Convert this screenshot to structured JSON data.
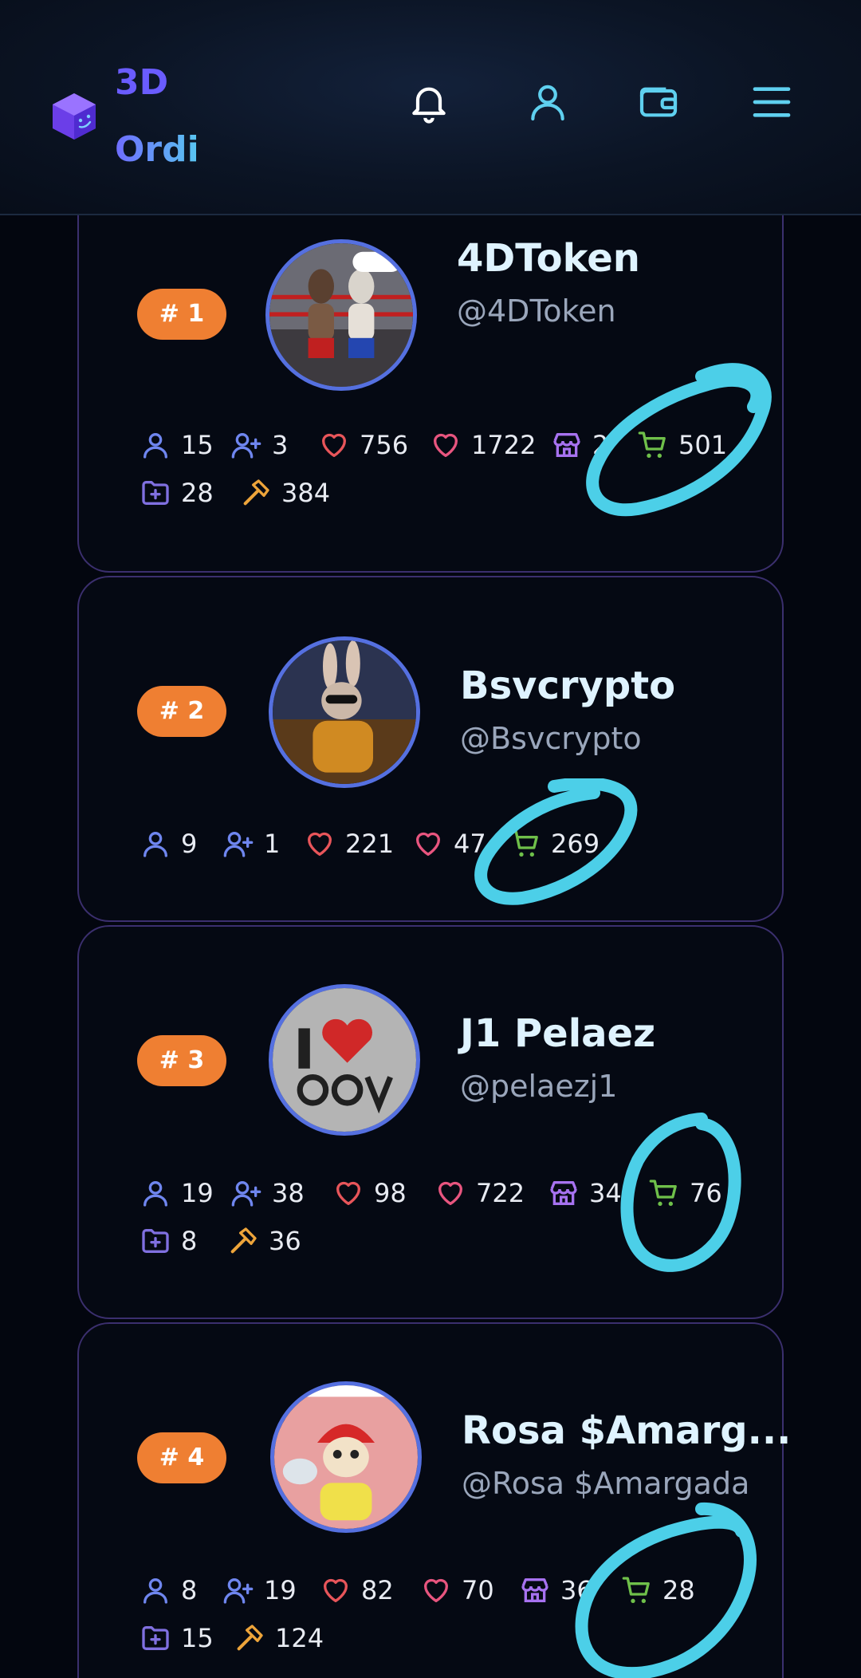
{
  "app": {
    "logo_line1": "3D",
    "logo_line2": "Ordi"
  },
  "header": {
    "icons": [
      "bell-icon",
      "user-icon",
      "wallet-icon",
      "menu-icon"
    ]
  },
  "colors": {
    "accent_orange": "#ef7f32",
    "card_border": "#3b2f6e",
    "avatar_ring": "#5570e0",
    "annotation": "#4ccfe8"
  },
  "leaderboard": [
    {
      "rank": "# 1",
      "name": "4DToken",
      "handle": "@4DToken",
      "followers": "15",
      "following": "3",
      "likes_given": "756",
      "likes_received": "1722",
      "stores": "2",
      "sales": "501",
      "collections": "28",
      "mints": "384"
    },
    {
      "rank": "# 2",
      "name": "Bsvcrypto",
      "handle": "@Bsvcrypto",
      "followers": "9",
      "following": "1",
      "likes_given": "221",
      "likes_received": "47",
      "sales": "269"
    },
    {
      "rank": "# 3",
      "name": "J1 Pelaez",
      "handle": "@pelaezj1",
      "followers": "19",
      "following": "38",
      "likes_given": "98",
      "likes_received": "722",
      "stores": "34",
      "sales": "76",
      "collections": "8",
      "mints": "36"
    },
    {
      "rank": "# 4",
      "name": "Rosa $Amarg...",
      "handle": "@Rosa $Amargada",
      "followers": "8",
      "following": "19",
      "likes_given": "82",
      "likes_received": "70",
      "stores": "36",
      "sales": "28",
      "collections": "15",
      "mints": "124"
    }
  ]
}
